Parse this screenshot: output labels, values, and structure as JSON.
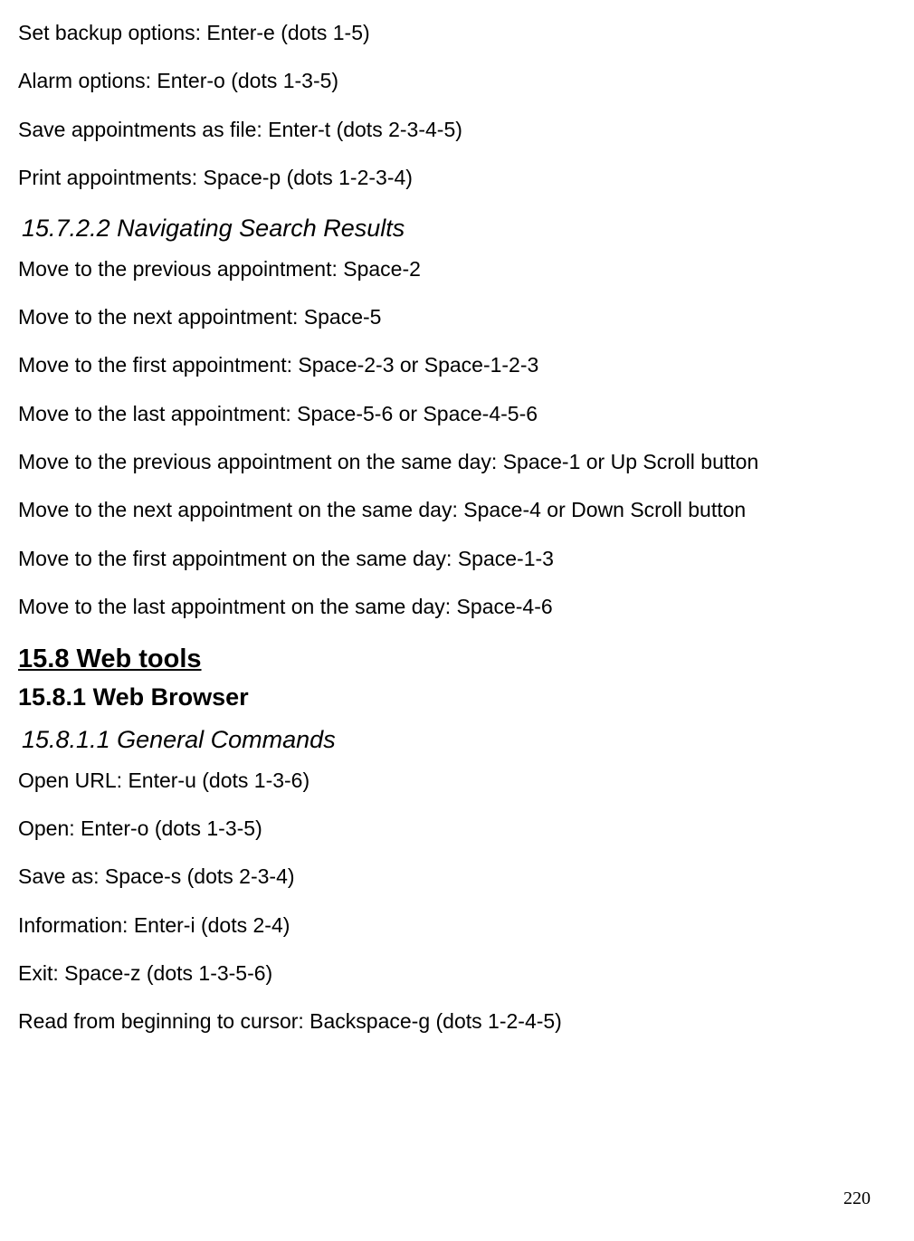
{
  "intro_lines": [
    "Set backup options: Enter-e (dots 1-5)",
    "Alarm options: Enter-o (dots 1-3-5)",
    "Save appointments as file: Enter-t (dots 2-3-4-5)",
    "Print appointments: Space-p (dots 1-2-3-4)"
  ],
  "section_15_7_2_2": {
    "heading": "15.7.2.2 Navigating Search Results",
    "lines": [
      "Move to the previous appointment: Space-2",
      "Move to the next appointment: Space-5",
      "Move to the first appointment: Space-2-3 or Space-1-2-3",
      "Move to the last appointment: Space-5-6 or Space-4-5-6",
      "Move to the previous appointment on the same day: Space-1 or Up Scroll button",
      "Move to the next appointment on the same day: Space-4 or Down Scroll button",
      "Move to the first appointment on the same day: Space-1-3",
      "Move to the last appointment on the same day: Space-4-6"
    ]
  },
  "section_15_8": {
    "heading": "15.8 Web tools",
    "sub_15_8_1": {
      "heading": "15.8.1 Web Browser",
      "sub_15_8_1_1": {
        "heading": "15.8.1.1 General Commands",
        "lines": [
          "Open URL: Enter-u (dots 1-3-6)",
          "Open: Enter-o (dots 1-3-5)",
          "Save as: Space-s (dots 2-3-4)",
          "Information: Enter-i (dots 2-4)",
          "Exit: Space-z (dots 1-3-5-6)",
          "Read from beginning to cursor: Backspace-g (dots 1-2-4-5)"
        ]
      }
    }
  },
  "page_number": "220"
}
